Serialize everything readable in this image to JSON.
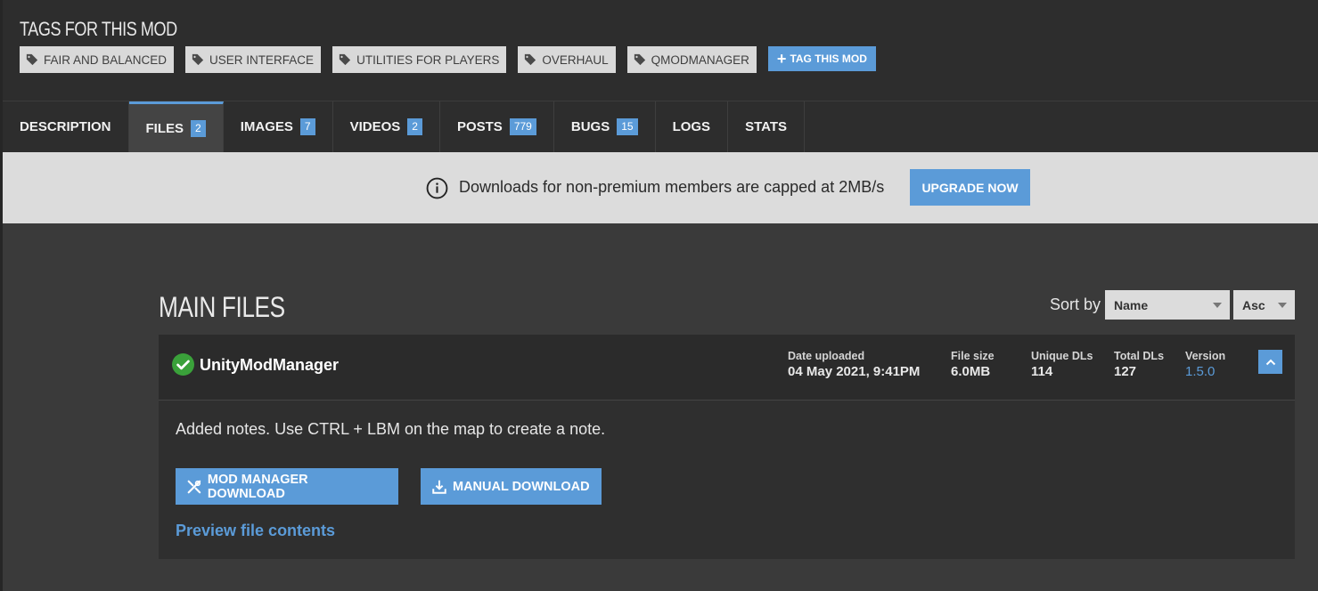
{
  "tags_section": {
    "title": "TAGS FOR THIS MOD",
    "tags": [
      "FAIR AND BALANCED",
      "USER INTERFACE",
      "UTILITIES FOR PLAYERS",
      "OVERHAUL",
      "QMODMANAGER"
    ],
    "add_tag_label": "TAG THIS MOD"
  },
  "tabs": [
    {
      "label": "DESCRIPTION",
      "count": null
    },
    {
      "label": "FILES",
      "count": "2",
      "active": true
    },
    {
      "label": "IMAGES",
      "count": "7"
    },
    {
      "label": "VIDEOS",
      "count": "2"
    },
    {
      "label": "POSTS",
      "count": "779"
    },
    {
      "label": "BUGS",
      "count": "15"
    },
    {
      "label": "LOGS",
      "count": null
    },
    {
      "label": "STATS",
      "count": null
    }
  ],
  "banner": {
    "text": "Downloads for non-premium members are capped at 2MB/s",
    "button": "UPGRADE NOW"
  },
  "main": {
    "title": "MAIN FILES",
    "sort_label": "Sort by",
    "sort_field": "Name",
    "sort_order": "Asc"
  },
  "file": {
    "name": "UnityModManager",
    "date_label": "Date uploaded",
    "date_value": "04 May 2021, 9:41PM",
    "size_label": "File size",
    "size_value": "6.0MB",
    "unique_label": "Unique DLs",
    "unique_value": "114",
    "total_label": "Total DLs",
    "total_value": "127",
    "version_label": "Version",
    "version_value": "1.5.0",
    "description": "Added notes. Use CTRL + LBM on the map to create a note.",
    "mod_manager_button": "MOD MANAGER DOWNLOAD",
    "manual_button": "MANUAL DOWNLOAD",
    "preview_link": "Preview file contents"
  },
  "colors": {
    "accent": "#5b9bd8",
    "success": "#3aa13a",
    "dark_bg": "#2d2d2d",
    "content_bg": "#3a3a3a"
  }
}
